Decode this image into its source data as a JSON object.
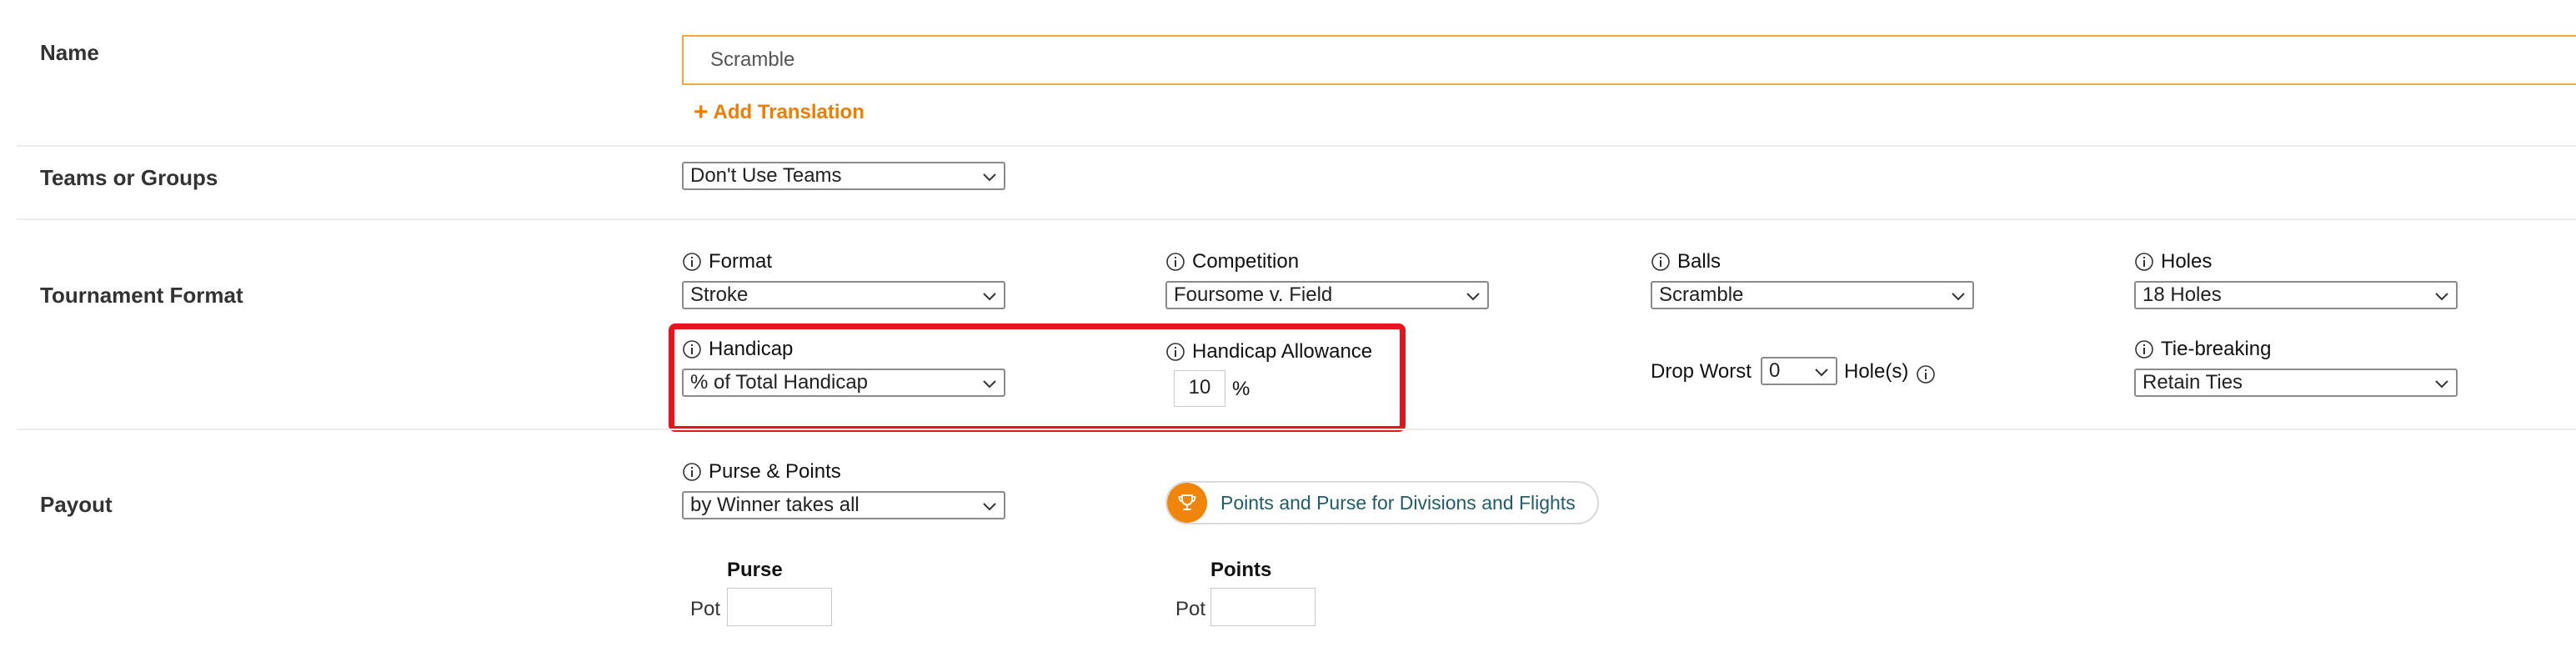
{
  "name_section": {
    "label": "Name",
    "input_value": "Scramble",
    "add_translation": "Add Translation"
  },
  "teams_section": {
    "label": "Teams or Groups",
    "select_value": "Don't Use Teams"
  },
  "format_section": {
    "label": "Tournament Format",
    "format": {
      "label": "Format",
      "value": "Stroke"
    },
    "competition": {
      "label": "Competition",
      "value": "Foursome v. Field"
    },
    "balls": {
      "label": "Balls",
      "value": "Scramble"
    },
    "holes": {
      "label": "Holes",
      "value": "18 Holes"
    },
    "handicap": {
      "label": "Handicap",
      "value": "% of Total Handicap"
    },
    "handicap_allowance": {
      "label": "Handicap Allowance",
      "value": "10",
      "unit": "%"
    },
    "drop_worst": {
      "label": "Drop Worst",
      "value": "0",
      "suffix": "Hole(s)"
    },
    "tie_breaking": {
      "label": "Tie-breaking",
      "value": "Retain Ties"
    }
  },
  "payout_section": {
    "label": "Payout",
    "purse_points": {
      "label": "Purse & Points",
      "value": "by Winner takes all"
    },
    "divisions_button": "Points and Purse for Divisions and Flights",
    "purse": {
      "header": "Purse",
      "pot_label": "Pot",
      "pot_value": ""
    },
    "points": {
      "header": "Points",
      "pot_label": "Pot",
      "pot_value": ""
    }
  },
  "colors": {
    "accent": "#f07c00",
    "highlight": "#e8141b",
    "input_border": "#f2a93b",
    "link_text": "#1f5d6a"
  },
  "icons": {
    "info": "info-circle-icon",
    "chevron": "chevron-down-icon",
    "trophy": "trophy-icon",
    "plus": "plus-icon"
  }
}
